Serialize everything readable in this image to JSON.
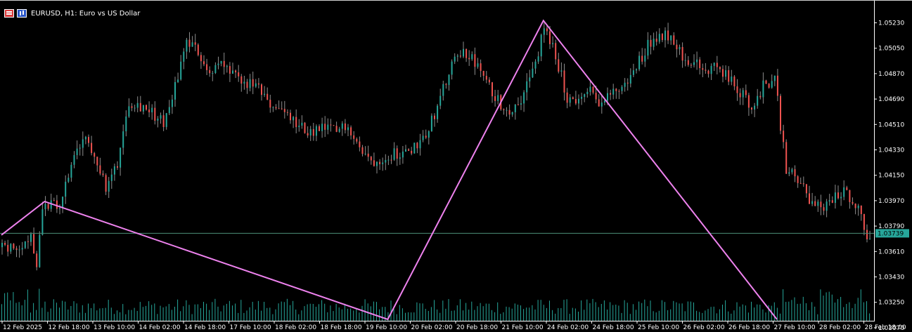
{
  "chart_window": {
    "symbol": "EURUSD",
    "timeframe": "H1",
    "description": "Euro vs US Dollar",
    "title": "EURUSD, H1:  Euro vs US Dollar"
  },
  "icons": [
    "bars-icon",
    "candle-icon"
  ],
  "colors": {
    "background": "#000000",
    "bull": "#26a69a",
    "bear": "#ef5350",
    "wick": "#8c8c8c",
    "volume": "#26a69a",
    "zigzag": "#ee82ee",
    "current_price_line": "#4c8f7a",
    "price_tag_bg": "#26a69a",
    "axis_text": "#ffffff"
  },
  "price_axis": {
    "labels": [
      "1.05230",
      "1.05050",
      "1.04870",
      "1.04690",
      "1.04510",
      "1.04330",
      "1.04150",
      "1.03970",
      "1.03790",
      "1.03610",
      "1.03430",
      "1.03250",
      "1.03070"
    ],
    "current_price": "1.03739"
  },
  "time_axis": {
    "labels": [
      "12 Feb 2025",
      "12 Feb 18:00",
      "13 Feb 10:00",
      "14 Feb 02:00",
      "14 Feb 18:00",
      "17 Feb 10:00",
      "18 Feb 02:00",
      "18 Feb 18:00",
      "19 Feb 10:00",
      "20 Feb 02:00",
      "20 Feb 18:00",
      "21 Feb 10:00",
      "24 Feb 02:00",
      "24 Feb 18:00",
      "25 Feb 10:00",
      "26 Feb 02:00",
      "26 Feb 18:00",
      "27 Feb 10:00",
      "28 Feb 02:00",
      "28 Feb 18:00"
    ]
  },
  "chart_data": {
    "type": "candlestick",
    "title": "EURUSD, H1:  Euro vs US Dollar",
    "ylim": [
      1.0297,
      1.0536
    ],
    "y_ticks": [
      1.0523,
      1.0505,
      1.0487,
      1.0469,
      1.0451,
      1.0433,
      1.0415,
      1.0397,
      1.0379,
      1.0361,
      1.0343,
      1.0325,
      1.0307
    ],
    "x_ticks": [
      "12 Feb 2025",
      "12 Feb 18:00",
      "13 Feb 10:00",
      "14 Feb 02:00",
      "14 Feb 18:00",
      "17 Feb 10:00",
      "18 Feb 02:00",
      "18 Feb 18:00",
      "19 Feb 10:00",
      "20 Feb 02:00",
      "20 Feb 18:00",
      "21 Feb 10:00",
      "24 Feb 02:00",
      "24 Feb 18:00",
      "25 Feb 10:00",
      "26 Feb 02:00",
      "26 Feb 18:00",
      "27 Feb 10:00",
      "28 Feb 02:00",
      "28 Feb 18:00"
    ],
    "close_path": [
      [
        0,
        1.0364
      ],
      [
        6,
        1.0366
      ],
      [
        10,
        1.0372
      ],
      [
        12,
        1.0352
      ],
      [
        14,
        1.0395
      ],
      [
        20,
        1.0392
      ],
      [
        24,
        1.0422
      ],
      [
        28,
        1.044
      ],
      [
        32,
        1.0432
      ],
      [
        36,
        1.0404
      ],
      [
        40,
        1.0424
      ],
      [
        44,
        1.0468
      ],
      [
        50,
        1.0463
      ],
      [
        56,
        1.0452
      ],
      [
        60,
        1.0478
      ],
      [
        64,
        1.051
      ],
      [
        68,
        1.0502
      ],
      [
        72,
        1.0488
      ],
      [
        76,
        1.0494
      ],
      [
        80,
        1.0485
      ],
      [
        84,
        1.048
      ],
      [
        88,
        1.0478
      ],
      [
        92,
        1.0466
      ],
      [
        96,
        1.0462
      ],
      [
        100,
        1.0455
      ],
      [
        104,
        1.0448
      ],
      [
        108,
        1.0445
      ],
      [
        112,
        1.0448
      ],
      [
        116,
        1.0446
      ],
      [
        120,
        1.0452
      ],
      [
        124,
        1.0434
      ],
      [
        128,
        1.0425
      ],
      [
        132,
        1.0428
      ],
      [
        136,
        1.0431
      ],
      [
        140,
        1.043
      ],
      [
        144,
        1.0438
      ],
      [
        148,
        1.0448
      ],
      [
        152,
        1.047
      ],
      [
        156,
        1.0492
      ],
      [
        160,
        1.0503
      ],
      [
        164,
        1.0495
      ],
      [
        168,
        1.048
      ],
      [
        172,
        1.0468
      ],
      [
        176,
        1.046
      ],
      [
        180,
        1.047
      ],
      [
        184,
        1.0488
      ],
      [
        188,
        1.0518
      ],
      [
        192,
        1.05
      ],
      [
        196,
        1.047
      ],
      [
        200,
        1.0468
      ],
      [
        204,
        1.0474
      ],
      [
        208,
        1.0466
      ],
      [
        212,
        1.0474
      ],
      [
        216,
        1.0478
      ],
      [
        220,
        1.0492
      ],
      [
        224,
        1.0508
      ],
      [
        228,
        1.0514
      ],
      [
        232,
        1.0515
      ],
      [
        236,
        1.05
      ],
      [
        240,
        1.0494
      ],
      [
        244,
        1.0489
      ],
      [
        248,
        1.0492
      ],
      [
        252,
        1.0483
      ],
      [
        256,
        1.0474
      ],
      [
        260,
        1.0464
      ],
      [
        264,
        1.0478
      ],
      [
        268,
        1.0484
      ],
      [
        272,
        1.0418
      ],
      [
        276,
        1.0413
      ],
      [
        280,
        1.0397
      ],
      [
        284,
        1.0391
      ],
      [
        288,
        1.0398
      ],
      [
        292,
        1.0404
      ],
      [
        296,
        1.0396
      ],
      [
        300,
        1.0374
      ]
    ],
    "volume_range": [
      0.2,
      1.0
    ],
    "zigzag": [
      {
        "bar": 0,
        "price": 1.03727
      },
      {
        "bar": 15,
        "price": 1.03964
      },
      {
        "bar": 134,
        "price": 1.02938
      },
      {
        "bar": 188,
        "price": 1.05246
      },
      {
        "bar": 269,
        "price": 1.02938
      }
    ],
    "current_price": 1.03739,
    "legend": null
  }
}
